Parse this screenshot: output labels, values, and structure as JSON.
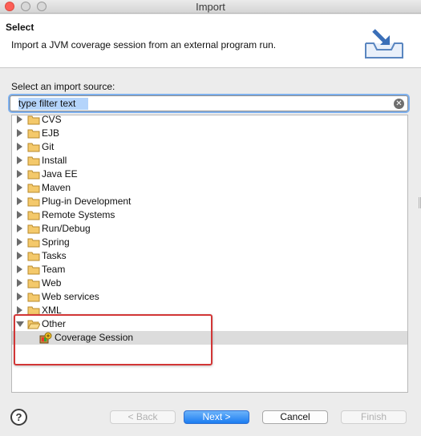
{
  "window": {
    "title": "Import"
  },
  "header": {
    "title": "Select",
    "description": "Import a JVM coverage session from an external program run."
  },
  "source": {
    "label": "Select an import source:",
    "filter_value": "type filter text"
  },
  "tree": {
    "items": [
      {
        "label": "CVS",
        "expanded": false
      },
      {
        "label": "EJB",
        "expanded": false
      },
      {
        "label": "Git",
        "expanded": false
      },
      {
        "label": "Install",
        "expanded": false
      },
      {
        "label": "Java EE",
        "expanded": false
      },
      {
        "label": "Maven",
        "expanded": false
      },
      {
        "label": "Plug-in Development",
        "expanded": false
      },
      {
        "label": "Remote Systems",
        "expanded": false
      },
      {
        "label": "Run/Debug",
        "expanded": false
      },
      {
        "label": "Spring",
        "expanded": false
      },
      {
        "label": "Tasks",
        "expanded": false
      },
      {
        "label": "Team",
        "expanded": false
      },
      {
        "label": "Web",
        "expanded": false
      },
      {
        "label": "Web services",
        "expanded": false
      },
      {
        "label": "XML",
        "expanded": false
      },
      {
        "label": "Other",
        "expanded": true
      }
    ],
    "child": {
      "label": "Coverage Session",
      "icon": "coverage-session-icon",
      "selected": true
    }
  },
  "buttons": {
    "help": "?",
    "back": "< Back",
    "next": "Next >",
    "cancel": "Cancel",
    "finish": "Finish"
  },
  "colors": {
    "primary_button": "#1c7df1",
    "highlight_box": "#d23636",
    "selection": "#dcdcdc"
  }
}
